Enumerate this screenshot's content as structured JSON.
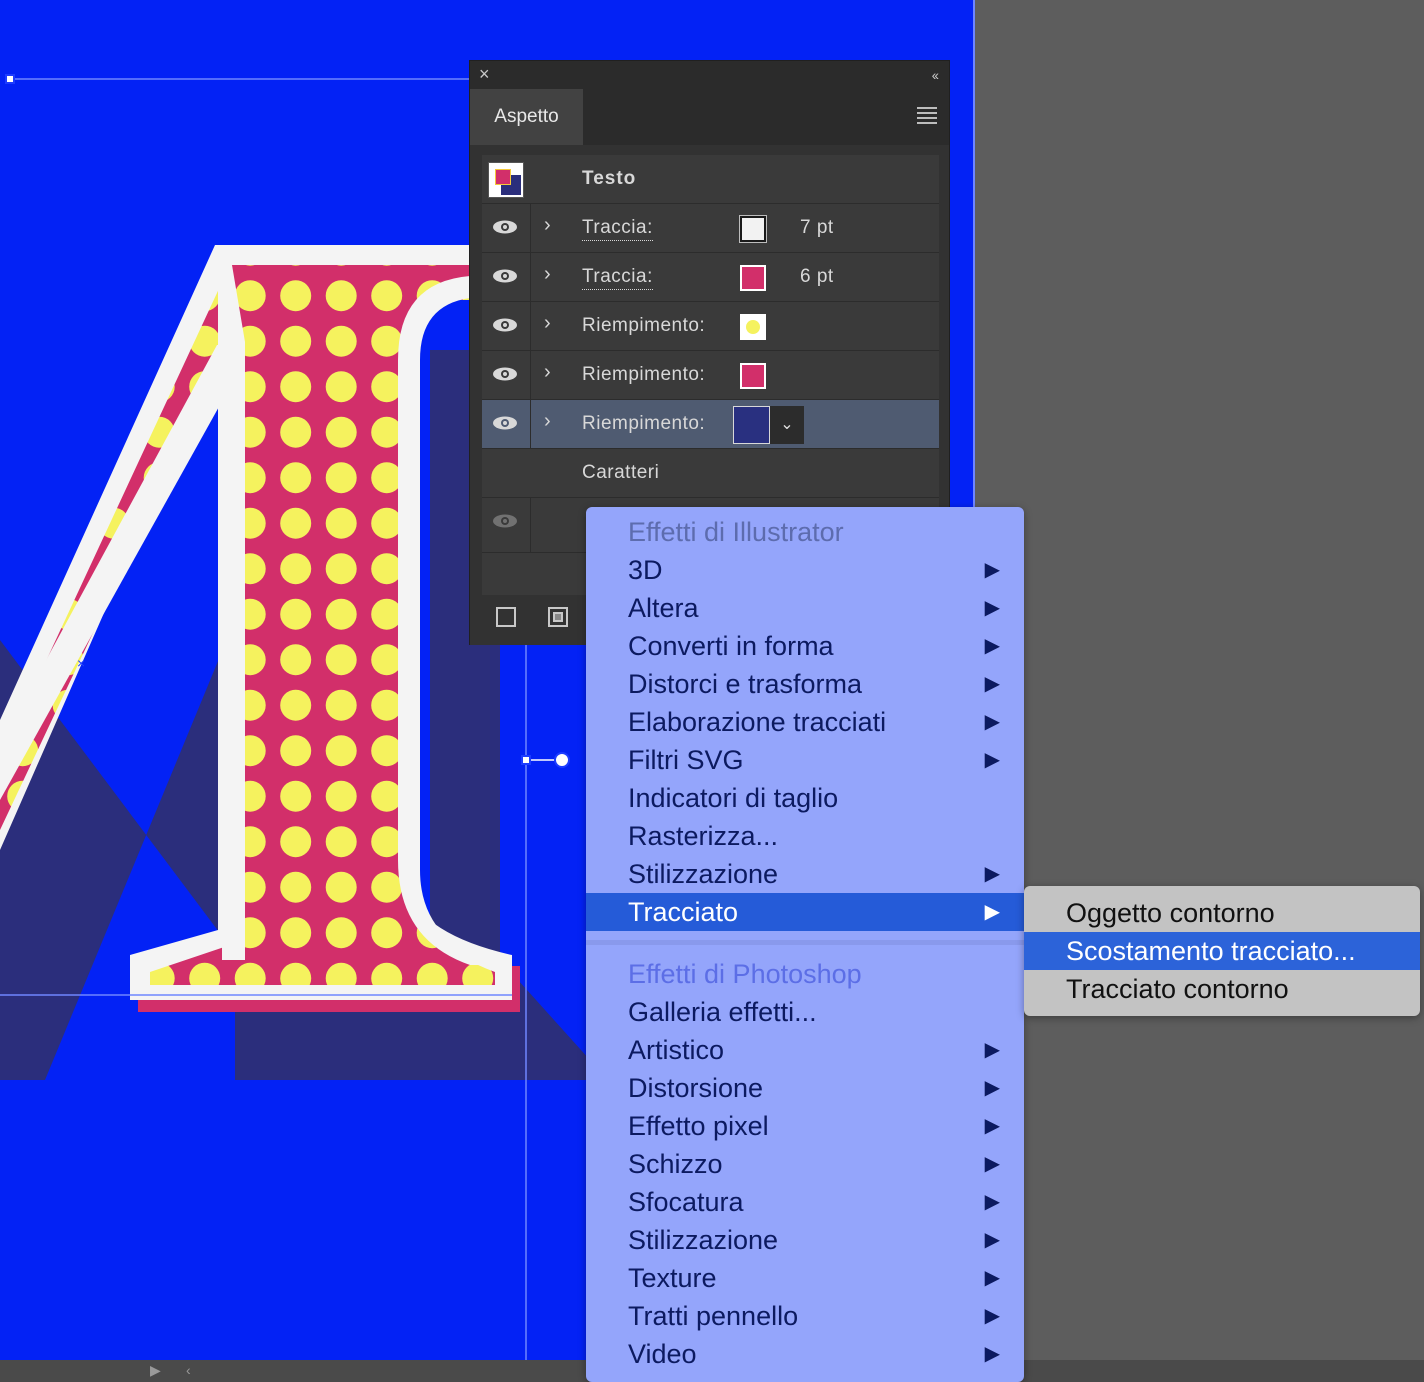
{
  "panel": {
    "tab_label": "Aspetto",
    "object_label": "Testo",
    "rows": [
      {
        "label": "Traccia:",
        "color": "#f2f2f2",
        "value": "7 pt"
      },
      {
        "label": "Traccia:",
        "color": "#d22f6a",
        "value": "6 pt"
      },
      {
        "label": "Riempimento:",
        "color": "#f5f25e",
        "value": ""
      },
      {
        "label": "Riempimento:",
        "color": "#d22f6a",
        "value": ""
      },
      {
        "label": "Riempimento:",
        "color": "#293080",
        "value": ""
      }
    ],
    "characters_label": "Caratteri"
  },
  "effects_menu": {
    "illustrator_header": "Effetti di Illustrator",
    "illustrator_items": [
      {
        "label": "3D",
        "submenu": true
      },
      {
        "label": "Altera",
        "submenu": true
      },
      {
        "label": "Converti in forma",
        "submenu": true
      },
      {
        "label": "Distorci e trasforma",
        "submenu": true
      },
      {
        "label": "Elaborazione tracciati",
        "submenu": true
      },
      {
        "label": "Filtri SVG",
        "submenu": true
      },
      {
        "label": "Indicatori di taglio",
        "submenu": false
      },
      {
        "label": "Rasterizza...",
        "submenu": false
      },
      {
        "label": "Stilizzazione",
        "submenu": true
      },
      {
        "label": "Tracciato",
        "submenu": true
      }
    ],
    "photoshop_header": "Effetti di Photoshop",
    "photoshop_items": [
      {
        "label": "Galleria effetti...",
        "submenu": false
      },
      {
        "label": "Artistico",
        "submenu": true
      },
      {
        "label": "Distorsione",
        "submenu": true
      },
      {
        "label": "Effetto pixel",
        "submenu": true
      },
      {
        "label": "Schizzo",
        "submenu": true
      },
      {
        "label": "Sfocatura",
        "submenu": true
      },
      {
        "label": "Stilizzazione",
        "submenu": true
      },
      {
        "label": "Texture",
        "submenu": true
      },
      {
        "label": "Tratti pennello",
        "submenu": true
      },
      {
        "label": "Video",
        "submenu": true
      }
    ],
    "active_item": "Tracciato"
  },
  "submenu": {
    "items": [
      "Oggetto contorno",
      "Scostamento tracciato...",
      "Tracciato contorno"
    ],
    "active_item": "Scostamento tracciato..."
  },
  "colors": {
    "artboard": "#0322f5",
    "letter_pink": "#d22f6a",
    "letter_dots": "#f5f25e",
    "letter_shadow": "#2b2e7c",
    "letter_outline": "#f4f4f4"
  }
}
